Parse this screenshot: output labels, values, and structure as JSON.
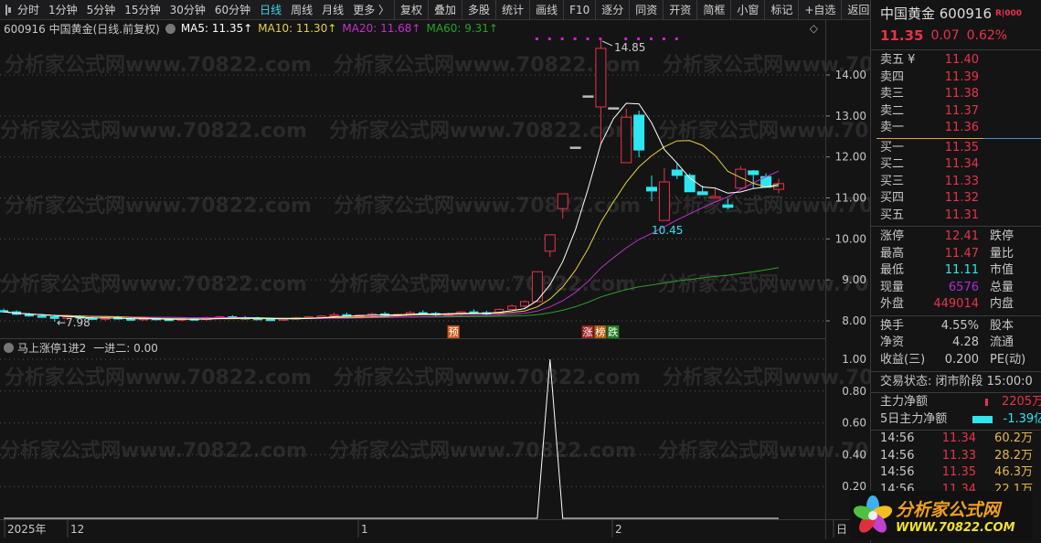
{
  "toolbar": {
    "items": [
      {
        "label": "分时"
      },
      {
        "label": "1分钟"
      },
      {
        "label": "5分钟"
      },
      {
        "label": "15分钟"
      },
      {
        "label": "30分钟"
      },
      {
        "label": "60分钟"
      },
      {
        "label": "日线",
        "active": true
      },
      {
        "label": "周线"
      },
      {
        "label": "月线"
      },
      {
        "label": "更多 〉"
      }
    ],
    "buttons": [
      {
        "label": "复权"
      },
      {
        "label": "叠加"
      },
      {
        "label": "多股"
      },
      {
        "label": "统计"
      },
      {
        "label": "画线"
      },
      {
        "label": "F10"
      },
      {
        "label": "逐分"
      },
      {
        "label": "同资"
      },
      {
        "label": "开资"
      },
      {
        "label": "简框"
      },
      {
        "label": "小窗"
      },
      {
        "label": "标记"
      },
      {
        "label": "+自选"
      },
      {
        "label": "返回"
      }
    ]
  },
  "info": {
    "title": "600916 中国黄金(日线.前复权)",
    "ma5": "MA5: 11.35↑",
    "ma10": "MA10: 11.30↑",
    "ma20": "MA20: 11.68↑",
    "ma60": "MA60: 9.31↑"
  },
  "colors": {
    "up": "#e8334a",
    "down": "#2ee6f0",
    "ma5": "#ffffff",
    "ma10": "#e8d040",
    "ma20": "#c030d0",
    "ma60": "#28a028"
  },
  "watermark": "分析家公式网www.70822.com",
  "price_axis": [
    "14.00",
    "13.00",
    "12.00",
    "11.00",
    "10.00",
    "9.00",
    "8.00"
  ],
  "high_label": "14.85",
  "low_label": "10.45",
  "left_low_label": "7.98",
  "markers": {
    "pre": "预",
    "zhang": "涨",
    "bang": "榜",
    "die": "跌"
  },
  "candles_early": [
    [
      8.25,
      8.3,
      8.2,
      8.22
    ],
    [
      8.22,
      8.26,
      8.14,
      8.16
    ],
    [
      8.16,
      8.2,
      8.1,
      8.12
    ],
    [
      8.12,
      8.16,
      8.08,
      8.1
    ],
    [
      8.1,
      8.15,
      7.98,
      8.06
    ],
    [
      8.06,
      8.12,
      8.02,
      8.1
    ],
    [
      8.1,
      8.14,
      8.05,
      8.07
    ],
    [
      8.07,
      8.1,
      8.02,
      8.04
    ],
    [
      8.04,
      8.1,
      8.0,
      8.08
    ],
    [
      8.08,
      8.12,
      8.03,
      8.05
    ],
    [
      8.05,
      8.09,
      8.0,
      8.03
    ],
    [
      8.03,
      8.08,
      8.0,
      8.06
    ],
    [
      8.06,
      8.1,
      8.02,
      8.04
    ],
    [
      8.04,
      8.08,
      8.0,
      8.02
    ],
    [
      8.02,
      8.06,
      7.99,
      8.05
    ],
    [
      8.05,
      8.09,
      8.02,
      8.03
    ],
    [
      8.03,
      8.1,
      8.01,
      8.08
    ],
    [
      8.08,
      8.12,
      8.04,
      8.1
    ],
    [
      8.1,
      8.14,
      8.06,
      8.08
    ],
    [
      8.08,
      8.12,
      8.03,
      8.06
    ],
    [
      8.06,
      8.1,
      8.02,
      8.04
    ],
    [
      8.04,
      8.08,
      8.0,
      8.02
    ],
    [
      8.02,
      8.07,
      8.0,
      8.05
    ],
    [
      8.05,
      8.1,
      8.03,
      8.08
    ],
    [
      8.08,
      8.12,
      8.05,
      8.1
    ],
    [
      8.1,
      8.14,
      8.06,
      8.12
    ],
    [
      8.12,
      8.2,
      8.08,
      8.15
    ],
    [
      8.15,
      8.2,
      8.1,
      8.12
    ],
    [
      8.12,
      8.16,
      8.08,
      8.14
    ],
    [
      8.14,
      8.2,
      8.1,
      8.17
    ],
    [
      8.17,
      8.22,
      8.12,
      8.14
    ],
    [
      8.14,
      8.18,
      8.1,
      8.16
    ],
    [
      8.16,
      8.24,
      8.12,
      8.2
    ],
    [
      8.2,
      8.26,
      8.15,
      8.18
    ],
    [
      8.18,
      8.22,
      8.12,
      8.15
    ],
    [
      8.15,
      8.2,
      8.1,
      8.17
    ],
    [
      8.17,
      8.24,
      8.14,
      8.22
    ],
    [
      8.22,
      8.28,
      8.16,
      8.2
    ],
    [
      8.2,
      8.25,
      8.14,
      8.18
    ],
    [
      8.18,
      8.3,
      8.15,
      8.28
    ],
    [
      8.28,
      8.4,
      8.25,
      8.36
    ],
    [
      8.36,
      8.5,
      8.32,
      8.47
    ]
  ],
  "candles_recent": [
    [
      8.47,
      9.2,
      8.47,
      9.2
    ],
    [
      9.7,
      10.1,
      9.56,
      10.1
    ],
    [
      10.74,
      11.1,
      10.5,
      11.1
    ],
    [
      12.24,
      12.24,
      12.24,
      12.24
    ],
    [
      13.49,
      13.49,
      13.49,
      13.49
    ],
    [
      13.22,
      14.85,
      12.3,
      14.65
    ],
    [
      13.2,
      13.2,
      13.2,
      13.2
    ],
    [
      11.86,
      13.18,
      11.86,
      12.97
    ],
    [
      13.02,
      13.13,
      11.99,
      12.17
    ],
    [
      11.26,
      11.55,
      10.92,
      11.17
    ],
    [
      10.45,
      11.73,
      10.45,
      11.39
    ],
    [
      11.68,
      11.86,
      11.46,
      11.55
    ],
    [
      11.55,
      11.6,
      11.15,
      11.15
    ],
    [
      11.15,
      11.3,
      11.08,
      11.08
    ],
    [
      10.99,
      11.24,
      10.99,
      11.03
    ],
    [
      10.83,
      10.98,
      10.73,
      10.77
    ],
    [
      11.24,
      11.78,
      11.2,
      11.7
    ],
    [
      11.66,
      11.68,
      11.24,
      11.57
    ],
    [
      11.52,
      11.6,
      11.26,
      11.26
    ],
    [
      11.21,
      11.47,
      11.11,
      11.35
    ]
  ],
  "limit_dot_indices": [
    42,
    43,
    44,
    45,
    46,
    47,
    49,
    50,
    51,
    52,
    53
  ],
  "indicator": {
    "title": "马上涨停1进2",
    "value": "一进二: 0.00",
    "spike_index": 43,
    "spike_value": 1,
    "axis": [
      "1.00",
      "0.80",
      "0.60",
      "0.40",
      "0.20"
    ]
  },
  "dates": [
    "2025年",
    "12",
    "1",
    "2",
    "日"
  ],
  "rp": {
    "name": "中国黄金 600916",
    "badge": "R|000",
    "price": "11.35",
    "change": "0.07",
    "pct": "0.62%",
    "asks": [
      {
        "l": "卖五 ¥",
        "v": "11.40"
      },
      {
        "l": "卖四",
        "v": "11.39"
      },
      {
        "l": "卖三",
        "v": "11.38"
      },
      {
        "l": "卖二",
        "v": "11.37"
      },
      {
        "l": "卖一",
        "v": "11.36"
      }
    ],
    "bids": [
      {
        "l": "买一",
        "v": "11.35"
      },
      {
        "l": "买二",
        "v": "11.34"
      },
      {
        "l": "买三",
        "v": "11.33"
      },
      {
        "l": "买四",
        "v": "11.32"
      },
      {
        "l": "买五",
        "v": "11.31"
      }
    ],
    "stats": [
      {
        "l": "涨停",
        "v": "12.41",
        "c": "red",
        "l2": "跌停"
      },
      {
        "l": "最高",
        "v": "11.47",
        "c": "red",
        "l2": "量比"
      },
      {
        "l": "最低",
        "v": "11.11",
        "c": "cyan",
        "l2": "市值"
      },
      {
        "l": "现量",
        "v": "6576",
        "c": "purple",
        "l2": "总量"
      },
      {
        "l": "外盘",
        "v": "449014",
        "c": "red",
        "l2": "内盘"
      }
    ],
    "stats2": [
      {
        "l": "换手",
        "v": "4.55%",
        "l2": "股本"
      },
      {
        "l": "净资",
        "v": "4.28",
        "l2": "流通"
      },
      {
        "l": "收益(三)",
        "v": "0.200",
        "l2": "PE(动)"
      }
    ],
    "status": "交易状态: 闭市阶段 15:00:0",
    "flow": [
      {
        "l": "主力净额",
        "v": "2205万",
        "c": "red"
      },
      {
        "l": "5日主力净额",
        "v": "-1.39亿",
        "c": "cyan"
      }
    ],
    "ticks": [
      {
        "t": "14:56",
        "p": "11.34",
        "v": "60.2万"
      },
      {
        "t": "14:56",
        "p": "11.33",
        "v": "28.2万"
      },
      {
        "t": "14:56",
        "p": "11.35",
        "v": "46.3万"
      },
      {
        "t": "14:56",
        "p": "11.34",
        "v": "22.1万"
      }
    ]
  },
  "logo": {
    "text": "分析家公式网",
    "url": "WWW.70822.COM"
  }
}
